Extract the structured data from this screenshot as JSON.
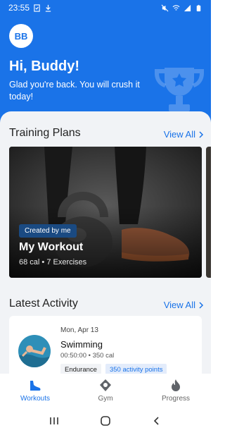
{
  "status_bar": {
    "time": "23:55"
  },
  "header": {
    "avatar_initials": "BB",
    "greeting": "Hi, Buddy!",
    "subtext": "Glad you're back. You will crush it today!"
  },
  "training_plans": {
    "title": "Training Plans",
    "view_all": "View All",
    "cards": [
      {
        "badge": "Created by me",
        "name": "My Workout",
        "meta": "68 cal • 7 Exercises"
      }
    ]
  },
  "latest_activity": {
    "title": "Latest Activity",
    "view_all": "View All",
    "items": [
      {
        "date": "Mon, Apr 13",
        "title": "Swimming",
        "meta": "00:50:00 • 350 cal",
        "tags": [
          "Endurance",
          "350 activity points"
        ]
      }
    ]
  },
  "tabs": [
    {
      "label": "Workouts",
      "icon": "shoe-icon",
      "active": true
    },
    {
      "label": "Gym",
      "icon": "location-icon",
      "active": false
    },
    {
      "label": "Progress",
      "icon": "flame-icon",
      "active": false
    }
  ],
  "colors": {
    "primary": "#1a73e8",
    "sheet_bg": "#f1f3f6"
  }
}
